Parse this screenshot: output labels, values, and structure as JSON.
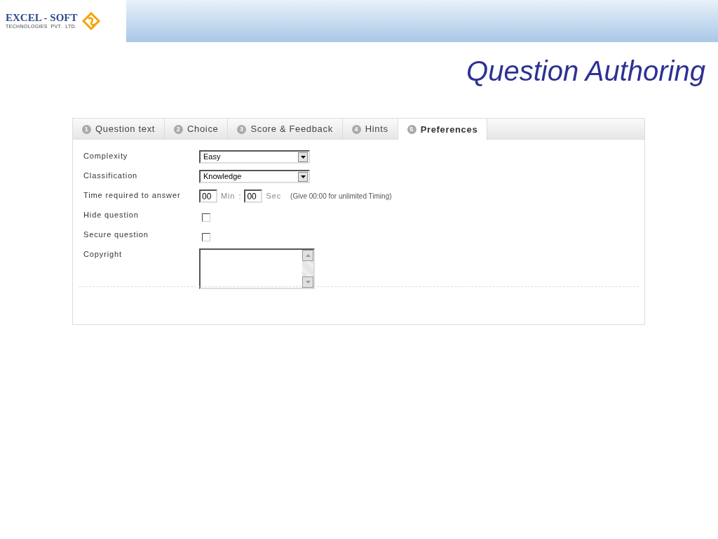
{
  "logo": {
    "name": "EXCEL - SOFT",
    "tagline": "TECHNOLOGIES  PVT.  LTD."
  },
  "slide_title": "Question Authoring",
  "tabs": [
    {
      "number": "1",
      "label": "Question text",
      "selected": false
    },
    {
      "number": "2",
      "label": "Choice",
      "selected": false
    },
    {
      "number": "3",
      "label": "Score & Feedback",
      "selected": false
    },
    {
      "number": "4",
      "label": "Hints",
      "selected": false
    },
    {
      "number": "5",
      "label": "Preferences",
      "selected": true
    }
  ],
  "fields": [
    {
      "kind": "select",
      "label": "Complexity",
      "value": "Easy"
    },
    {
      "kind": "select",
      "label": "Classification",
      "value": "Knowledge"
    },
    {
      "kind": "time",
      "label": "Time required to answer",
      "minutes": "00",
      "min_unit": "Min",
      "separator": ":",
      "seconds": "00",
      "sec_unit": "Sec",
      "hint": "(Give 00:00 for unlimited Timing)"
    },
    {
      "kind": "checkbox",
      "label": "Hide question",
      "checked": false
    },
    {
      "kind": "checkbox",
      "label": "Secure question",
      "checked": false
    },
    {
      "kind": "textarea",
      "label": "Copyright"
    }
  ]
}
